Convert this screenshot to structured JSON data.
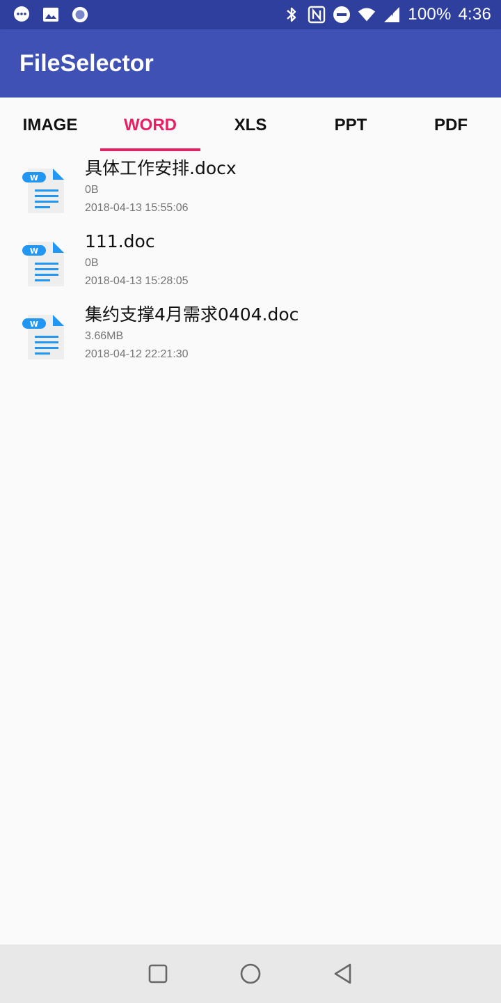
{
  "status_bar": {
    "left_icons": [
      "chat-bubble-icon",
      "image-icon",
      "circle-record-icon"
    ],
    "right_icons": [
      "bluetooth-icon",
      "nfc-icon",
      "do-not-disturb-icon",
      "wifi-icon",
      "signal-icon"
    ],
    "battery": "100%",
    "time": "4:36"
  },
  "app_bar": {
    "title": "FileSelector"
  },
  "tabs": [
    {
      "label": "IMAGE",
      "active": false
    },
    {
      "label": "WORD",
      "active": true
    },
    {
      "label": "XLS",
      "active": false
    },
    {
      "label": "PPT",
      "active": false
    },
    {
      "label": "PDF",
      "active": false
    }
  ],
  "files": [
    {
      "name": "具体工作安排.docx",
      "size": "0B",
      "date": "2018-04-13 15:55:06",
      "icon": "word-file-icon"
    },
    {
      "name": "111.doc",
      "size": "0B",
      "date": "2018-04-13 15:28:05",
      "icon": "word-file-icon"
    },
    {
      "name": "集约支撑4月需求0404.doc",
      "size": "3.66MB",
      "date": "2018-04-12 22:21:30",
      "icon": "word-file-icon"
    }
  ],
  "nav_bar": {
    "buttons": [
      "recents-square-icon",
      "home-circle-icon",
      "back-triangle-icon"
    ]
  },
  "colors": {
    "status_bar": "#2f3f9e",
    "app_bar": "#3f51b5",
    "accent": "#e91e63",
    "word_icon_blue": "#2196f3"
  }
}
